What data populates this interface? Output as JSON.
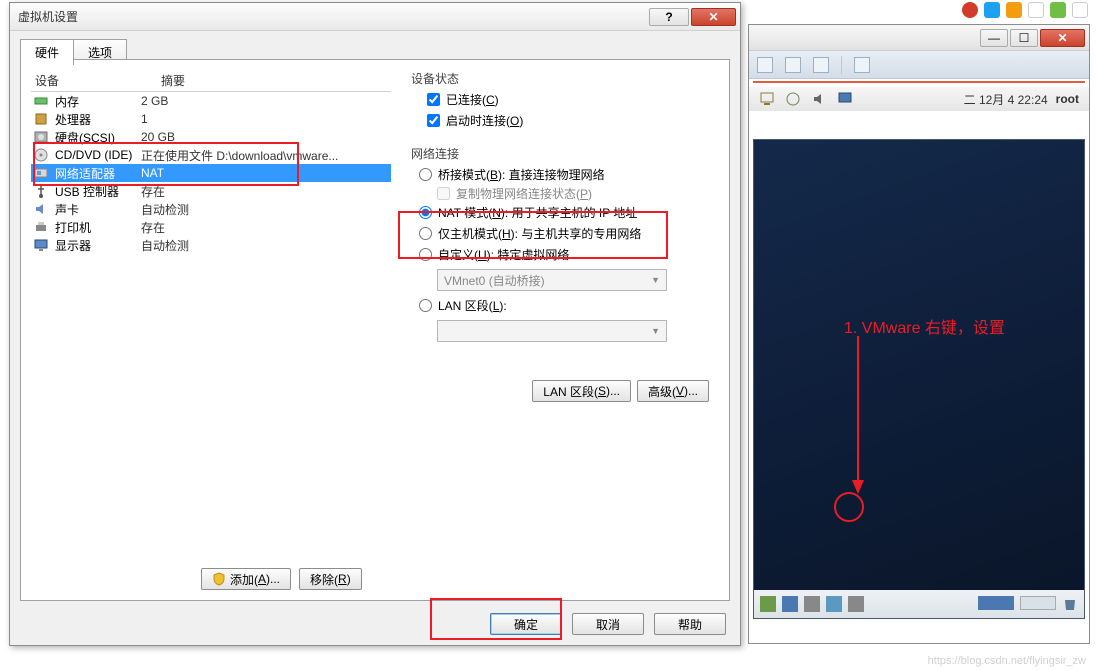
{
  "dialog": {
    "title": "虚拟机设置",
    "tabs": {
      "hardware": "硬件",
      "options": "选项"
    },
    "headers": {
      "device": "设备",
      "summary": "摘要"
    },
    "hw": [
      {
        "name": "内存",
        "sum": "2 GB",
        "icon": "memory"
      },
      {
        "name": "处理器",
        "sum": "1",
        "icon": "cpu"
      },
      {
        "name": "硬盘(SCSI)",
        "sum": "20 GB",
        "icon": "disk"
      },
      {
        "name": "CD/DVD (IDE)",
        "sum": "正在使用文件 D:\\download\\vmware...",
        "icon": "cd"
      },
      {
        "name": "网络适配器",
        "sum": "NAT",
        "icon": "nic",
        "selected": true
      },
      {
        "name": "USB 控制器",
        "sum": "存在",
        "icon": "usb"
      },
      {
        "name": "声卡",
        "sum": "自动检测",
        "icon": "sound"
      },
      {
        "name": "打印机",
        "sum": "存在",
        "icon": "printer"
      },
      {
        "name": "显示器",
        "sum": "自动检测",
        "icon": "display"
      }
    ],
    "state": {
      "title": "设备状态",
      "connected": "已连接(",
      "connected_k": "C",
      "connected_suf": ")",
      "connect_power": "启动时连接(",
      "connect_power_k": "O",
      "connect_power_suf": ")"
    },
    "net": {
      "title": "网络连接",
      "bridge": "桥接模式(",
      "bridge_k": "B",
      "bridge_suf": "): 直接连接物理网络",
      "replicate": "复制物理网络连接状态(",
      "replicate_k": "P",
      "replicate_suf": ")",
      "nat": "NAT 模式(",
      "nat_k": "N",
      "nat_suf": "): 用于共享主机的 IP 地址",
      "host": "仅主机模式(",
      "host_k": "H",
      "host_suf": "): 与主机共享的专用网络",
      "custom": "自定义(",
      "custom_k": "U",
      "custom_suf": "): 特定虚拟网络",
      "combo": "VMnet0 (自动桥接)",
      "lan": "LAN 区段(",
      "lan_k": "L",
      "lan_suf": "):"
    },
    "btns": {
      "lanseg": "LAN 区段(",
      "lanseg_k": "S",
      "lanseg_suf": ")...",
      "adv": "高级(",
      "adv_k": "V",
      "adv_suf": ")..."
    },
    "add": "添加(",
    "add_k": "A",
    "add_suf": ")...",
    "remove": "移除(",
    "remove_k": "R",
    "remove_suf": ")",
    "ok": "确定",
    "cancel": "取消",
    "help": "帮助"
  },
  "vm": {
    "clock": "二  12月  4 22:24",
    "user": "root"
  },
  "annot": "1. VMware 右键，设置",
  "watermark": "https://blog.csdn.net/flyingsir_zw"
}
